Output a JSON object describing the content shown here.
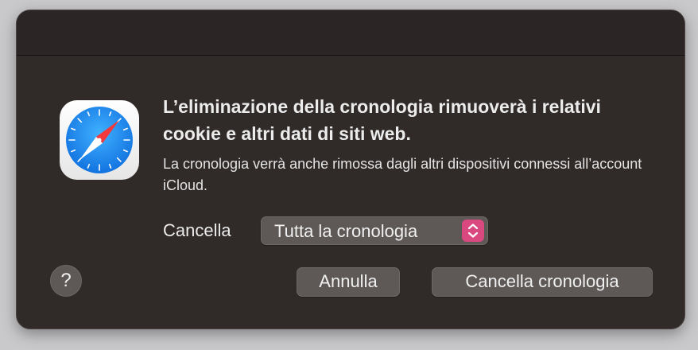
{
  "dialog": {
    "app_icon": "safari-icon",
    "title": "L’eliminazione della cronologia rimuoverà i relativi cookie e altri dati di siti web.",
    "message": "La cronologia verrà anche rimossa dagli altri dispositivi connessi all’account iCloud.",
    "range_label": "Cancella",
    "range_selected": "Tutta la cronologia",
    "help_label": "?",
    "cancel_label": "Annulla",
    "confirm_label": "Cancella cronologia"
  },
  "colors": {
    "dialog_bg": "#302a29",
    "button_bg": "#5e5857",
    "accent": "#d9487f",
    "safari_blue": "#1a8cf5"
  }
}
